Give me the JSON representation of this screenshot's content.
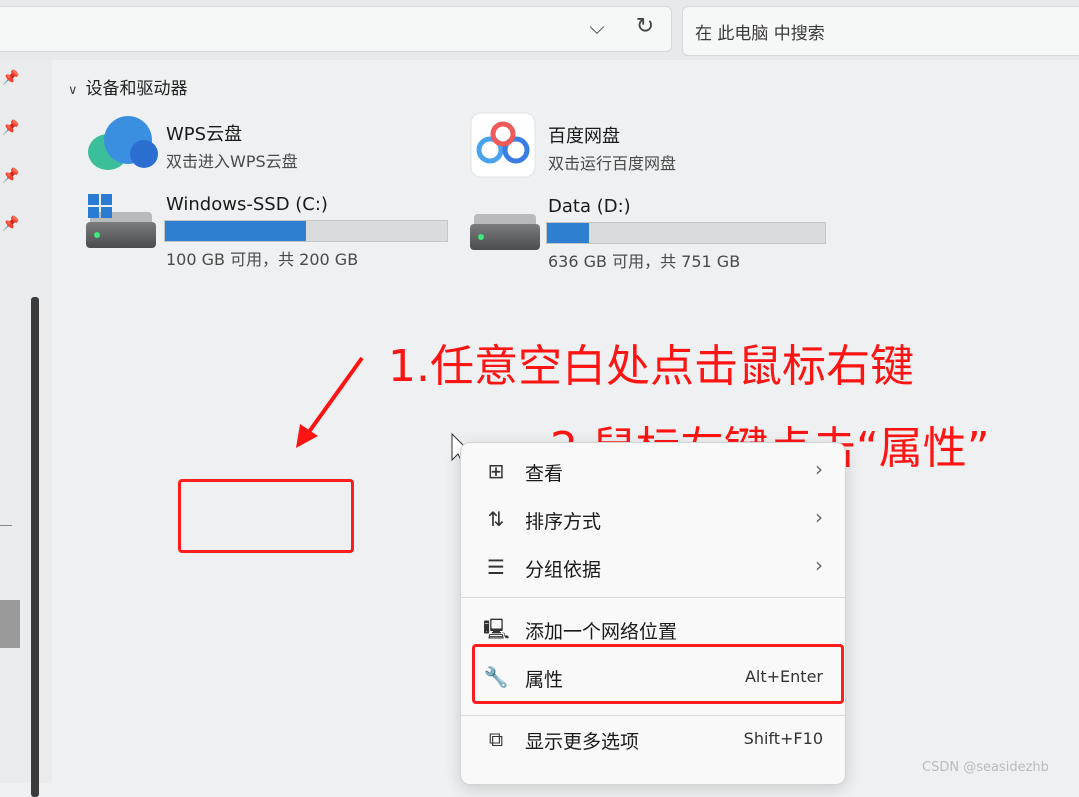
{
  "search": {
    "placeholder": "在 此电脑 中搜索"
  },
  "section": {
    "title": "设备和驱动器"
  },
  "cloud": [
    {
      "name": "WPS云盘",
      "sub": "双击进入WPS云盘"
    },
    {
      "name": "百度网盘",
      "sub": "双击运行百度网盘"
    }
  ],
  "drives": [
    {
      "name": "Windows-SSD (C:)",
      "sub": "100 GB 可用，共 200 GB",
      "used_fraction": 0.5
    },
    {
      "name": "Data (D:)",
      "sub": "636 GB 可用，共 751 GB",
      "used_fraction": 0.15
    }
  ],
  "annotations": {
    "step1": "1.任意空白处点击鼠标右键",
    "step2": "2.鼠标左键点击“属性”"
  },
  "menu": {
    "items": [
      {
        "label": "查看",
        "icon": "grid-icon",
        "submenu": true
      },
      {
        "label": "排序方式",
        "icon": "sort-icon",
        "submenu": true
      },
      {
        "label": "分组依据",
        "icon": "group-icon",
        "submenu": true
      },
      {
        "label": "添加一个网络位置",
        "icon": "network-location-icon"
      },
      {
        "label": "属性",
        "icon": "wrench-icon",
        "shortcut": "Alt+Enter"
      },
      {
        "label": "显示更多选项",
        "icon": "more-options-icon",
        "shortcut": "Shift+F10"
      }
    ]
  },
  "watermark": "CSDN @seasidezhb",
  "colors": {
    "annotation": "#ff1414",
    "progress": "#2f7fd0"
  }
}
